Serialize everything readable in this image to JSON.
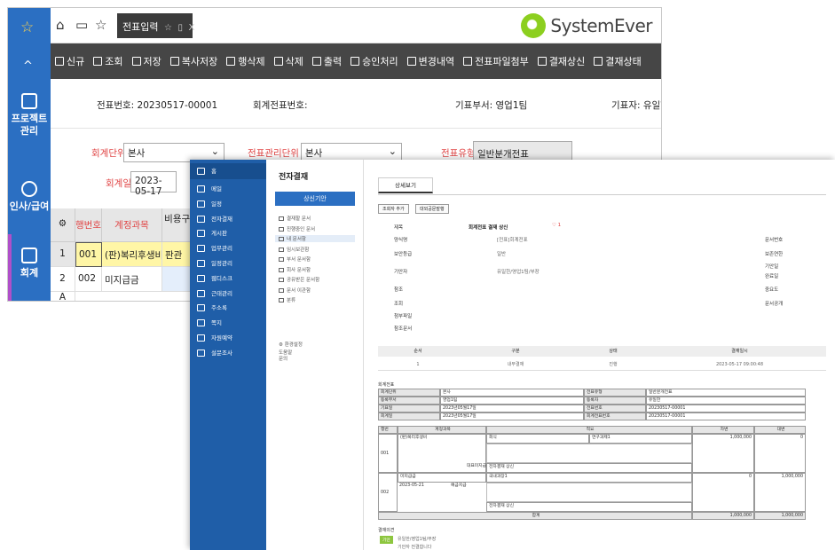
{
  "back_window": {
    "nav": {
      "project_label_1": "프로젝트",
      "project_label_2": "관리",
      "hr_label": "인사/급여",
      "accounting_label": "회계"
    },
    "tab": {
      "label": "전표입력",
      "close": "X"
    },
    "logo_text": "SystemEver",
    "toolbar": [
      "신규",
      "조회",
      "저장",
      "복사저장",
      "행삭제",
      "삭제",
      "출력",
      "승인처리",
      "변경내역",
      "전표파일첨부",
      "결재상신",
      "결재상태"
    ],
    "info": {
      "voucher_no": "전표번호: 20230517-00001",
      "accounting_voucher_no": "회계전표번호:",
      "dept": "기표부서: 영업1팀",
      "writer": "기표자: 유일한"
    },
    "form": {
      "unit_label": "회계단위",
      "unit_value": "본사",
      "mgmt_unit_label": "전표관리단위",
      "mgmt_unit_value": "본사",
      "type_label": "전표유형",
      "type_value": "일반분개전표",
      "date_label": "회계일",
      "date_value": "2023-05-17"
    },
    "grid": {
      "headers": [
        "",
        "행번호",
        "계정과목",
        "비용구분"
      ],
      "rows": [
        {
          "num": "1",
          "line": "001",
          "account": "(판)복리후생비",
          "cost": "판관"
        },
        {
          "num": "2",
          "line": "002",
          "account": "미지급금",
          "cost": ""
        }
      ],
      "next_marker": "A"
    }
  },
  "front_window": {
    "nav": [
      "홈",
      "메일",
      "일정",
      "전자결재",
      "게시판",
      "업무관리",
      "일정관리",
      "웹디스크",
      "근태관리",
      "주소록",
      "쪽지",
      "자원예약",
      "설문조사"
    ],
    "side": {
      "title": "전자결재",
      "new_button": "상신기안",
      "items": [
        "결재할 문서",
        "진행중인 문서",
        "내 문서함",
        "임시보관함",
        "부서 문서함",
        "회사 문서함",
        "공유받은 문서함",
        "문서 이관함",
        "분류"
      ],
      "settings": "환경설정",
      "extra_1": "도움말",
      "extra_2": "문의"
    },
    "main": {
      "tab": "상세보기",
      "buttons": [
        "조회자 추가",
        "대외공문발행"
      ],
      "fields_left": [
        "제목",
        "양식명",
        "보안등급",
        "기안자",
        "참조",
        "조회",
        "첨부파일",
        "참조문서"
      ],
      "subject": "회계전표 결재 상신",
      "form_name": "[전표]회계전표",
      "security": "일반",
      "drafter": "유일한/영업1팀/부장",
      "fields_right": [
        "문서번호",
        "보존연한",
        "기안일",
        "완료일",
        "중요도",
        "문서공개"
      ],
      "line_headers": [
        "순서",
        "구분",
        "상태",
        "결재일시"
      ],
      "line_row": [
        "1",
        "내부결재",
        "진행",
        "2023-05-17 09:00:48"
      ],
      "doc": {
        "section": "회계전표",
        "r1": [
          "회계단위",
          "본사",
          "전표유형",
          "일반분개전표"
        ],
        "r2": [
          "등록부서",
          "영업1팀",
          "등록자",
          "유일한"
        ],
        "r3": [
          "기표일",
          "2023년05월17일",
          "전표번호",
          "20230517-00001"
        ],
        "r4": [
          "회계일",
          "2023년05월17일",
          "회계전표번호",
          "20230517-00001"
        ],
        "head": [
          "행번",
          "계정과목",
          "적요",
          "차변",
          "대변"
        ],
        "row1": {
          "line": "001",
          "account": "(판)복리후생비",
          "memo1": "회식",
          "memo2": "연구과제1",
          "debit": "1,000,000",
          "credit": "0",
          "sub": "대표미지급",
          "sub2": "전자결재 상신"
        },
        "row2": {
          "line": "002",
          "account": "미지급금",
          "memo1": "국내과장1",
          "date": "2023-05-21",
          "sub": "예금지급",
          "debit": "0",
          "credit": "1,000,000",
          "sub2": "전자결재 상신"
        },
        "total_label": "합계",
        "total_debit": "1,000,000",
        "total_credit": "1,000,000"
      },
      "opinion_label": "결재의견",
      "opinion_badge": "기안",
      "opinion_user": "유일한/영업1팀/부장",
      "opinion_text": "기안자 전결합니다"
    }
  }
}
